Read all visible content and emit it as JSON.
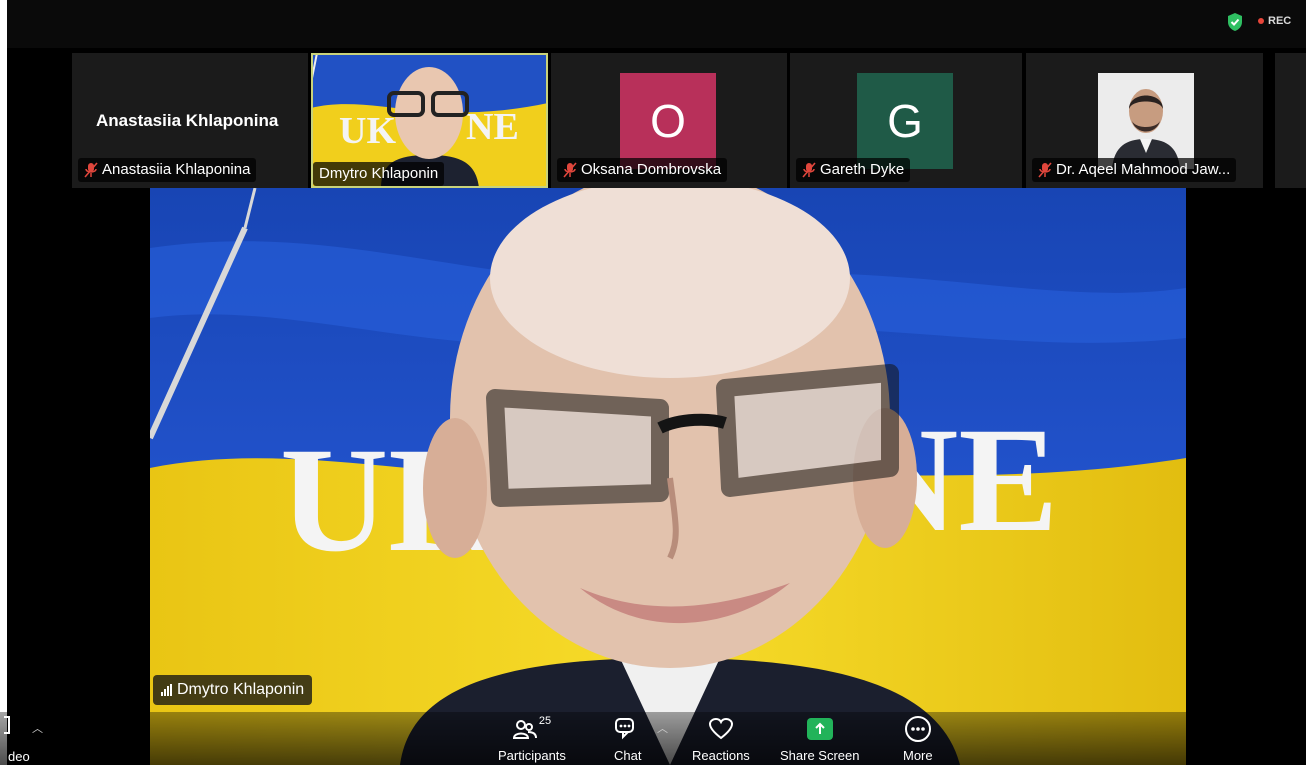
{
  "topbar": {
    "rec_label": "REC",
    "shield_icon": "security-shield-icon",
    "colors": {
      "shield": "#2fbf62",
      "rec_dot": "#e8463a"
    }
  },
  "participants_strip": [
    {
      "display_name": "Anastasiia Khlaponina",
      "name_tag": "Anastasiia Khlaponina",
      "muted": true,
      "video": false
    },
    {
      "name_tag": "Dmytro Khlaponin",
      "muted": false,
      "video": true,
      "active": true
    },
    {
      "name_tag": "Oksana Dombrovska",
      "muted": true,
      "avatar_letter": "O",
      "avatar_color": "#b8305a"
    },
    {
      "name_tag": "Gareth Dyke",
      "muted": true,
      "avatar_letter": "G",
      "avatar_color": "#1f5a47"
    },
    {
      "name_tag": "Dr. Aqeel Mahmood Jaw...",
      "muted": true,
      "video": false,
      "has_photo": true
    }
  ],
  "main_video": {
    "speaker_tag": "Dmytro Khlaponin",
    "background_text_left": "UKR",
    "background_text_right": "NE",
    "flag_colors": {
      "blue": "#1a4fc7",
      "yellow": "#f3d21a"
    }
  },
  "toolbar": {
    "left_label": "deo",
    "participants_label": "Participants",
    "participants_count": "25",
    "chat_label": "Chat",
    "reactions_label": "Reactions",
    "share_label": "Share Screen",
    "more_label": "More",
    "share_color": "#22b35a"
  }
}
